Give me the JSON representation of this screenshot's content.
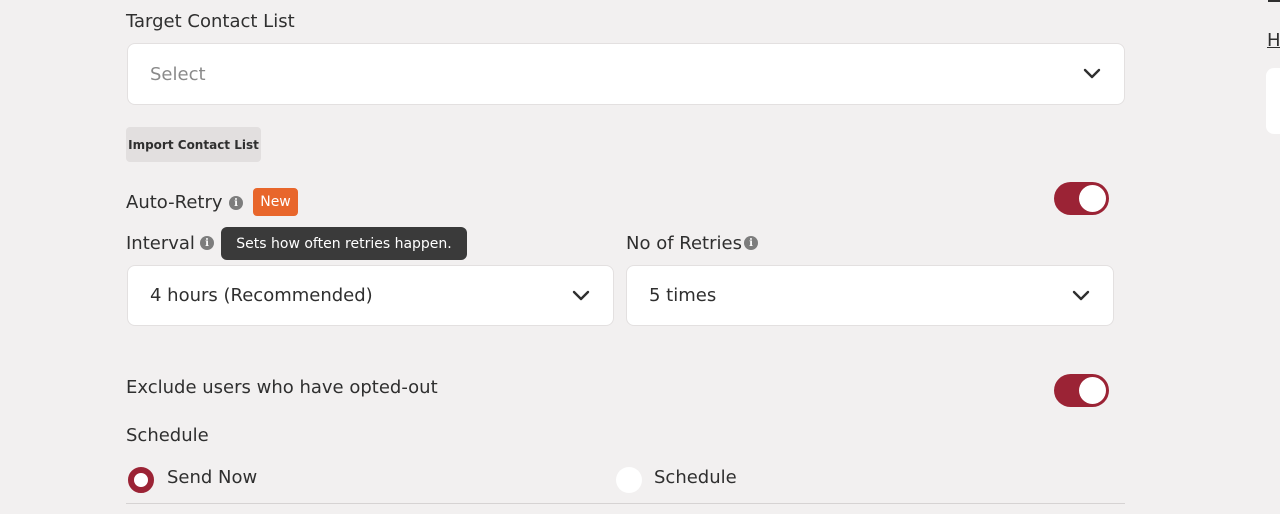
{
  "target_contact_list": {
    "label": "Target Contact List",
    "select_placeholder": "Select"
  },
  "import_button_label": "Import Contact List",
  "auto_retry": {
    "label": "Auto-Retry",
    "badge": "New",
    "enabled": true
  },
  "interval": {
    "label": "Interval",
    "tooltip": "Sets how often retries happen.",
    "selected": "4 hours (Recommended)"
  },
  "retries": {
    "label": "No of Retries",
    "selected": "5 times"
  },
  "exclude_opted_out": {
    "label": "Exclude users who have opted-out",
    "enabled": true
  },
  "schedule": {
    "label": "Schedule",
    "options": [
      {
        "label": "Send Now",
        "selected": true
      },
      {
        "label": "Schedule",
        "selected": false
      }
    ]
  },
  "right_edge_link": "H",
  "colors": {
    "accent": "#9b2335",
    "badge": "#e8662b",
    "tooltip_bg": "#3a3a3a"
  }
}
